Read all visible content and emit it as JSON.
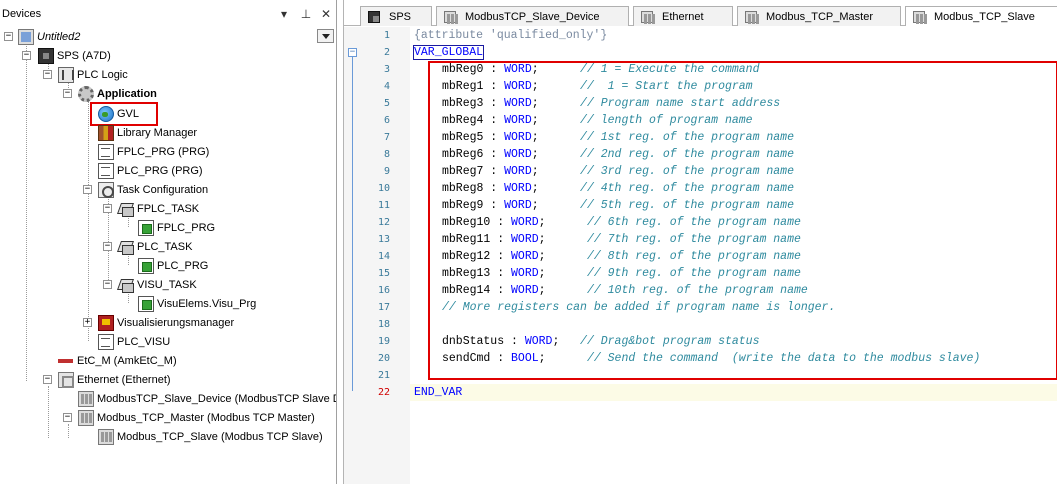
{
  "devices": {
    "title": "Devices",
    "buttons": {
      "dropdown": "▾",
      "pin": "⊥",
      "close": "✕"
    },
    "tree": [
      {
        "label": "Untitled2",
        "icon": "project-icon"
      },
      {
        "label": "SPS (A7D)",
        "icon": "plc-cpu-icon"
      },
      {
        "label": "PLC Logic",
        "icon": "plc-logic-icon"
      },
      {
        "label": "Application",
        "icon": "application-gear-icon"
      },
      {
        "label": "GVL",
        "icon": "gvl-globe-icon"
      },
      {
        "label": "Library Manager",
        "icon": "library-books-icon"
      },
      {
        "label": "FPLC_PRG (PRG)",
        "icon": "program-document-icon"
      },
      {
        "label": "PLC_PRG (PRG)",
        "icon": "program-document-icon"
      },
      {
        "label": "Task Configuration",
        "icon": "task-configuration-icon"
      },
      {
        "label": "FPLC_TASK",
        "icon": "task-icon"
      },
      {
        "label": "FPLC_PRG",
        "icon": "program-call-icon"
      },
      {
        "label": "PLC_TASK",
        "icon": "task-icon"
      },
      {
        "label": "PLC_PRG",
        "icon": "program-call-icon"
      },
      {
        "label": "VISU_TASK",
        "icon": "task-icon"
      },
      {
        "label": "VisuElems.Visu_Prg",
        "icon": "program-call-icon"
      },
      {
        "label": "Visualisierungsmanager",
        "icon": "visualization-manager-icon"
      },
      {
        "label": "PLC_VISU",
        "icon": "visualization-document-icon"
      },
      {
        "label": "EtC_M (AmkEtC_M)",
        "icon": "etc-bus-icon"
      },
      {
        "label": "Ethernet (Ethernet)",
        "icon": "ethernet-icon"
      },
      {
        "label": "ModbusTCP_Slave_Device (ModbusTCP Slave Device)",
        "icon": "modbus-device-icon"
      },
      {
        "label": "Modbus_TCP_Master (Modbus TCP Master)",
        "icon": "modbus-device-icon"
      },
      {
        "label": "Modbus_TCP_Slave (Modbus TCP Slave)",
        "icon": "modbus-device-icon"
      }
    ]
  },
  "editor": {
    "tabs": [
      {
        "label": "SPS",
        "icon": "plc-cpu-icon"
      },
      {
        "label": "ModbusTCP_Slave_Device",
        "icon": "modbus-device-icon"
      },
      {
        "label": "Ethernet",
        "icon": "ethernet-icon"
      },
      {
        "label": "Modbus_TCP_Master",
        "icon": "modbus-device-icon"
      },
      {
        "label": "Modbus_TCP_Slave",
        "icon": "modbus-device-icon"
      }
    ],
    "line_numbers": [
      "1",
      "2",
      "3",
      "4",
      "5",
      "6",
      "7",
      "8",
      "9",
      "10",
      "11",
      "12",
      "13",
      "14",
      "15",
      "16",
      "17",
      "18",
      "19",
      "20",
      "21",
      "22"
    ],
    "fold_markers": [
      "−",
      "−"
    ],
    "code": {
      "l1_attr": "{attribute 'qualified_only'}",
      "l2_kw": "VAR_GLOBAL",
      "vars": [
        {
          "name": "mbReg0 : ",
          "type": "WORD",
          "pad": ";      ",
          "comment": "// 1 = Execute the command"
        },
        {
          "name": "mbReg1 : ",
          "type": "WORD",
          "pad": ";      ",
          "comment": "//  1 = Start the program"
        },
        {
          "name": "mbReg3 : ",
          "type": "WORD",
          "pad": ";      ",
          "comment": "// Program name start address"
        },
        {
          "name": "mbReg4 : ",
          "type": "WORD",
          "pad": ";      ",
          "comment": "// length of program name"
        },
        {
          "name": "mbReg5 : ",
          "type": "WORD",
          "pad": ";      ",
          "comment": "// 1st reg. of the program name"
        },
        {
          "name": "mbReg6 : ",
          "type": "WORD",
          "pad": ";      ",
          "comment": "// 2nd reg. of the program name"
        },
        {
          "name": "mbReg7 : ",
          "type": "WORD",
          "pad": ";      ",
          "comment": "// 3rd reg. of the program name"
        },
        {
          "name": "mbReg8 : ",
          "type": "WORD",
          "pad": ";      ",
          "comment": "// 4th reg. of the program name"
        },
        {
          "name": "mbReg9 : ",
          "type": "WORD",
          "pad": ";      ",
          "comment": "// 5th reg. of the program name"
        },
        {
          "name": "mbReg10 : ",
          "type": "WORD",
          "pad": ";      ",
          "comment": "// 6th reg. of the program name"
        },
        {
          "name": "mbReg11 : ",
          "type": "WORD",
          "pad": ";      ",
          "comment": "// 7th reg. of the program name"
        },
        {
          "name": "mbReg12 : ",
          "type": "WORD",
          "pad": ";      ",
          "comment": "// 8th reg. of the program name"
        },
        {
          "name": "mbReg13 : ",
          "type": "WORD",
          "pad": ";      ",
          "comment": "// 9th reg. of the program name"
        },
        {
          "name": "mbReg14 : ",
          "type": "WORD",
          "pad": ";      ",
          "comment": "// 10th reg. of the program name"
        }
      ],
      "l17_comment": "// More registers can be added if program name is longer.",
      "status_var": {
        "name": "dnbStatus : ",
        "type": "WORD",
        "pad": ";   ",
        "comment": "// Drag&bot program status"
      },
      "cmd_var": {
        "name": "sendCmd : ",
        "type": "BOOL",
        "pad": ";      ",
        "comment": "// Send the command  (write the data to the modbus slave)"
      },
      "l22_kw": "END_VAR"
    },
    "current_line": "22"
  },
  "colors": {
    "keyword": "#0000ff",
    "comment": "#2e8a9e",
    "attribute": "#7a8aa0",
    "annotation_red": "#e00000",
    "line_number": "#3a7a9a"
  }
}
